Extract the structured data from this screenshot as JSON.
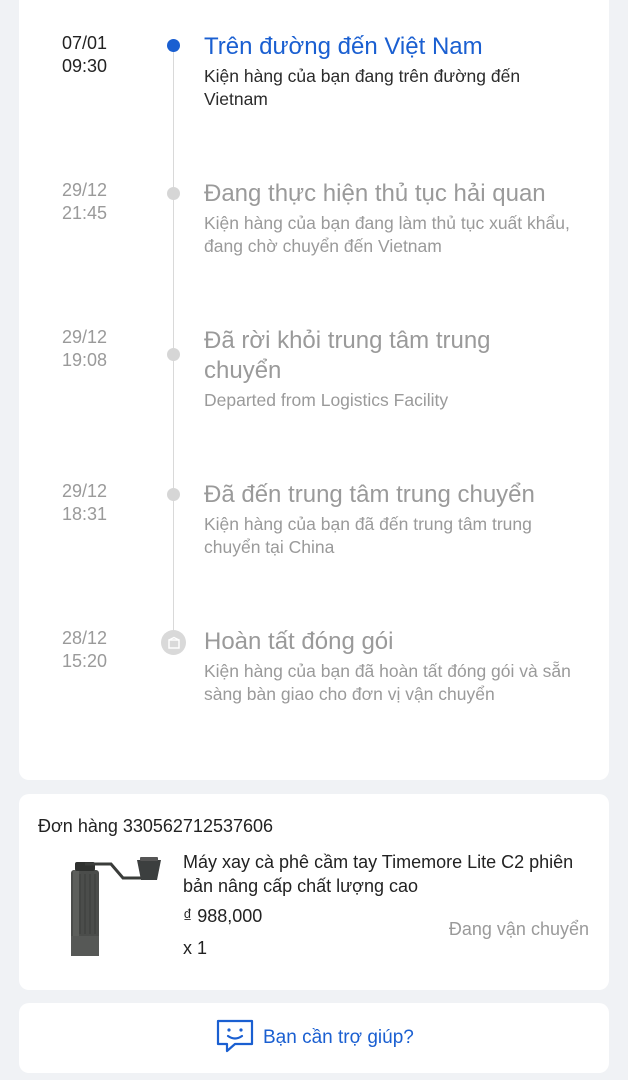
{
  "timeline": [
    {
      "date": "07/01",
      "time": "09:30",
      "title": "Trên đường đến Việt Nam",
      "desc": "Kiện hàng của bạn đang trên đường đến Vietnam"
    },
    {
      "date": "29/12",
      "time": "21:45",
      "title": "Đang thực hiện thủ tục hải quan",
      "desc": "Kiện hàng của bạn đang làm thủ tục xuất khẩu, đang chờ chuyển đến Vietnam"
    },
    {
      "date": "29/12",
      "time": "19:08",
      "title": "Đã rời khỏi trung tâm trung chuyển",
      "desc": "Departed from Logistics Facility"
    },
    {
      "date": "29/12",
      "time": "18:31",
      "title": "Đã đến trung tâm trung chuyển",
      "desc": "Kiện hàng của bạn đã đến trung tâm trung chuyển tại China"
    },
    {
      "date": "28/12",
      "time": "15:20",
      "title": "Hoàn tất đóng gói",
      "desc": "Kiện hàng của bạn đã hoàn tất đóng gói và sẵn sàng bàn giao cho đơn vị vận chuyển"
    }
  ],
  "order": {
    "id_label": "Đơn hàng 330562712537606",
    "product_name": "Máy xay cà phê cầm tay Timemore Lite C2 phiên bản nâng cấp chất lượng cao",
    "price": "₫ 988,000",
    "qty": "x 1",
    "status": "Đang vận chuyển"
  },
  "help": {
    "label": "Bạn cần trợ giúp?",
    "icon": "chat-support-icon"
  },
  "colors": {
    "accent": "#1a5fd1",
    "muted": "#9a9a9a",
    "background": "#f0f2f5"
  }
}
